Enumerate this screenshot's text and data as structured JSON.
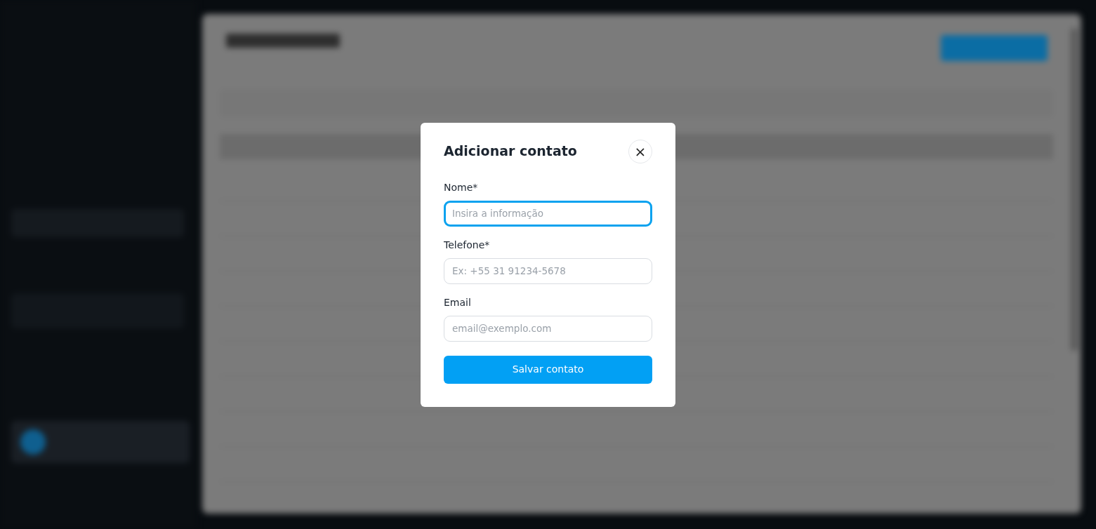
{
  "dialog": {
    "title": "Adicionar contato",
    "close_icon": "×",
    "fields": [
      {
        "label": "Nome*",
        "placeholder": "Insira a informação",
        "focused": true
      },
      {
        "label": "Telefone*",
        "placeholder": "Ex: +55 31 91234-5678",
        "focused": false
      },
      {
        "label": "Email",
        "placeholder": "email@exemplo.com",
        "focused": false
      }
    ],
    "submit_button": "Salvar contato"
  }
}
